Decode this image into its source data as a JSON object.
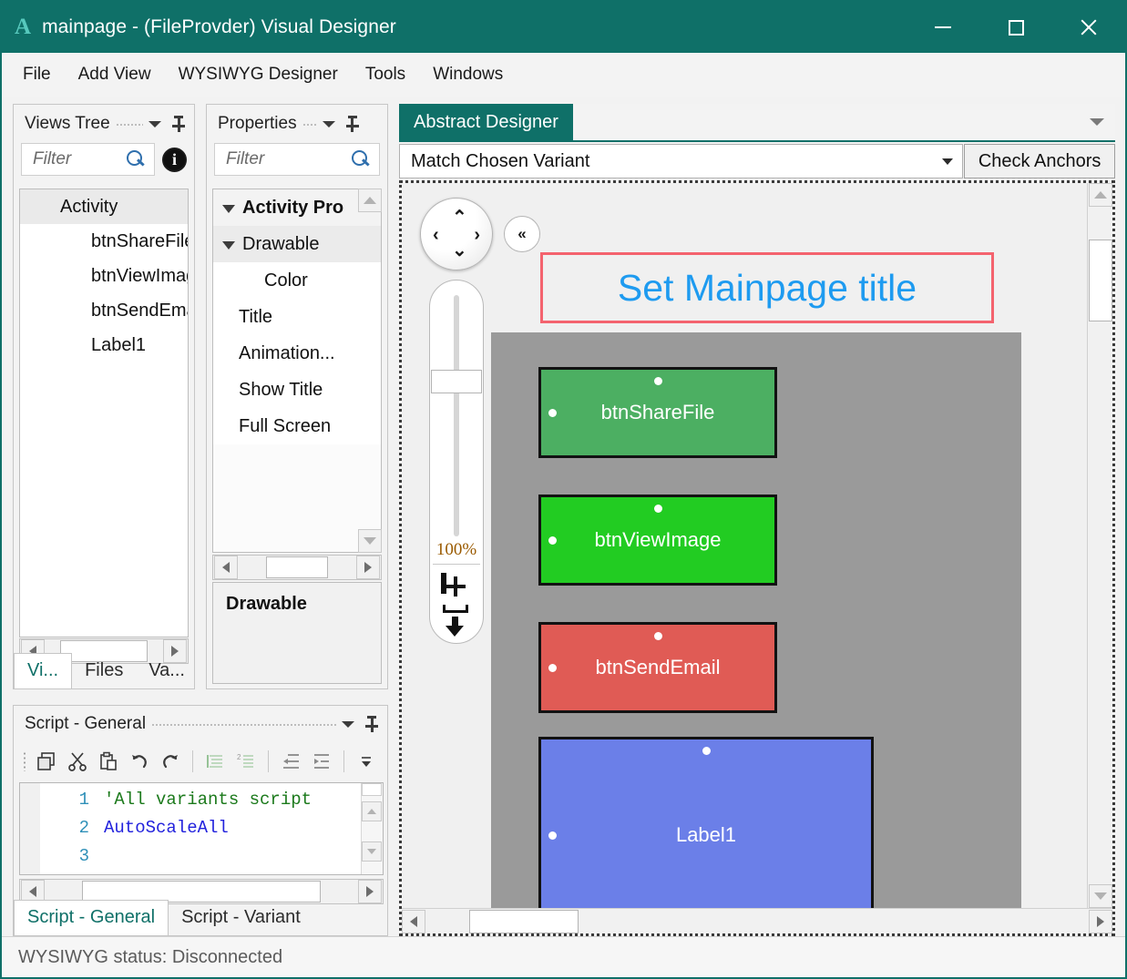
{
  "window": {
    "logo": "A",
    "title": "mainpage - (FileProvder) Visual Designer",
    "minimize_label": "minimize-icon",
    "maximize_label": "maximize-icon",
    "close_label": "close-icon",
    "titlebar_color": "#0f7068"
  },
  "menubar": {
    "items": [
      {
        "label": "File"
      },
      {
        "label": "Add View"
      },
      {
        "label": "WYSIWYG Designer"
      },
      {
        "label": "Tools"
      },
      {
        "label": "Windows"
      }
    ]
  },
  "views_panel": {
    "title": "Views Tree",
    "filter_placeholder": "Filter",
    "filter_value": "",
    "info_glyph": "i",
    "tree": [
      {
        "label": "Activity",
        "level": 0,
        "selected": true
      },
      {
        "label": "btnShareFile",
        "level": 1,
        "selected": false
      },
      {
        "label": "btnViewImage",
        "level": 1,
        "selected": false
      },
      {
        "label": "btnSendEmail",
        "level": 1,
        "selected": false
      },
      {
        "label": "Label1",
        "level": 1,
        "selected": false
      }
    ],
    "tabs": [
      {
        "label": "Vi...",
        "active": true
      },
      {
        "label": "Files",
        "active": false
      },
      {
        "label": "Va...",
        "active": false
      }
    ]
  },
  "properties_panel": {
    "title": "Properties",
    "filter_placeholder": "Filter",
    "filter_value": "",
    "rows": [
      {
        "label": "Activity Pro",
        "level": 0,
        "expander": "open"
      },
      {
        "label": "Drawable",
        "level": 1,
        "expander": "open"
      },
      {
        "label": "Color",
        "level": 2,
        "expander": "none"
      },
      {
        "label": "Title",
        "level": 1,
        "expander": "none"
      },
      {
        "label": "Animation...",
        "level": 1,
        "expander": "none"
      },
      {
        "label": "Show Title",
        "level": 1,
        "expander": "none"
      },
      {
        "label": "Full Screen",
        "level": 1,
        "expander": "none"
      }
    ],
    "description": "Drawable"
  },
  "script_panel": {
    "title": "Script - General",
    "toolbar": [
      {
        "name": "copy-icon"
      },
      {
        "name": "cut-icon"
      },
      {
        "name": "paste-icon"
      },
      {
        "name": "undo-icon"
      },
      {
        "name": "redo-icon"
      },
      {
        "name": "comment-icon"
      },
      {
        "name": "uncomment-icon"
      },
      {
        "name": "outdent-icon"
      },
      {
        "name": "indent-icon"
      },
      {
        "name": "overflow-icon"
      }
    ],
    "code": [
      {
        "num": "1",
        "text": "'All variants script",
        "kind": "comment"
      },
      {
        "num": "2",
        "text": "AutoScaleAll",
        "kind": "keyword"
      },
      {
        "num": "3",
        "text": "",
        "kind": "plain"
      }
    ],
    "tabs": [
      {
        "label": "Script - General",
        "active": true
      },
      {
        "label": "Script - Variant",
        "active": false
      }
    ]
  },
  "designer": {
    "tab_label": "Abstract Designer",
    "variant_value": "Match Chosen Variant",
    "check_anchors_label": "Check Anchors",
    "zoom_percent": "100%",
    "nav_up": "⌃",
    "nav_down": "⌄",
    "nav_left": "‹",
    "nav_right": "›",
    "collapse_label": "«",
    "move_icon_name": "move-icon",
    "download_icon_name": "download-icon",
    "preview": {
      "title_text": "Set Mainpage title",
      "title_color": "#1e9bf0",
      "title_border_color": "#f4636e",
      "body_color": "#9a9a9a",
      "views": [
        {
          "label": "btnShareFile",
          "color": "#4caf62"
        },
        {
          "label": "btnViewImage",
          "color": "#22cc22"
        },
        {
          "label": "btnSendEmail",
          "color": "#e05b55"
        },
        {
          "label": "Label1",
          "color": "#6b7fe8"
        }
      ]
    }
  },
  "statusbar": {
    "text": "WYSIWYG status: Disconnected"
  }
}
